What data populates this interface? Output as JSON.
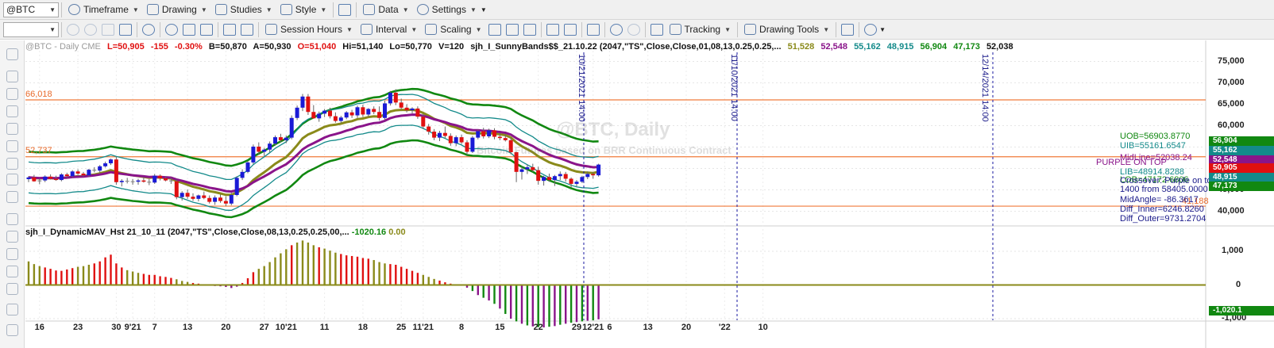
{
  "toolbar1": {
    "symbol": "@BTC",
    "items": [
      "Timeframe",
      "Drawing",
      "Studies",
      "Style",
      "Data",
      "Settings"
    ]
  },
  "toolbar2": {
    "session_label": "Session Hours",
    "interval_label": "Interval",
    "scaling_label": "Scaling",
    "tracking_label": "Tracking",
    "drawing_tools_label": "Drawing Tools"
  },
  "legend": {
    "symbol": "@BTC - Daily  CME",
    "last": "L=50,905",
    "change": "-155",
    "pct": "-0.30%",
    "bid": "B=50,870",
    "ask": "A=50,930",
    "open": "O=51,040",
    "high": "Hi=51,140",
    "low": "Lo=50,770",
    "volume": "V=120",
    "study": "sjh_I_SunnyBands$$_21.10.22 (2047,\"TS\",Close,Close,01,08,13,0.25,0.25,...",
    "v1": "51,528",
    "v2": "52,548",
    "v3": "55,162",
    "v4": "48,915",
    "v5": "56,904",
    "v6": "47,173",
    "v7": "52,038"
  },
  "legend2": {
    "study": "sjh_I_DynamicMAV_Hst 21_10_11 (2047,\"TS\",Close,Close,08,13,0.25,0.25,00,...",
    "v1": "-1020.16",
    "v2": "0.00"
  },
  "price_axis": [
    "75,000",
    "70,000",
    "65,000",
    "60,000",
    "55,000",
    "50,000",
    "45,000",
    "40,000"
  ],
  "osc_axis": [
    "1,000",
    "0",
    "-1,000"
  ],
  "x_axis": [
    "16",
    "23",
    "30",
    "9'21",
    "7",
    "13",
    "20",
    "27",
    "10'21",
    "11",
    "18",
    "25",
    "11'21",
    "8",
    "15",
    "22",
    "29",
    "12'21",
    "6",
    "13",
    "20",
    "'22",
    "10"
  ],
  "hlines": {
    "h1": "66,018",
    "h2": "52,737",
    "h3": "41,188"
  },
  "badges": {
    "uob": "56,904",
    "uib": "55,162",
    "mid": "52,548",
    "last": "50,905",
    "lib": "48,915",
    "lob": "47,173",
    "osc": "-1,020.1"
  },
  "annotations": {
    "uob": "UOB=56903.8770",
    "uib": "UIB=55161.6547",
    "midline": "MidLine=52038.24",
    "purple": "PURPLE ON TOP",
    "lib": "LIB=48914.8288",
    "lob": "LOB=47172.6806",
    "crossover": "Crossover: Purple on top at",
    "crossover2": "1400 from 58405.0000",
    "midangle": "MidAngle= -86.3617",
    "diff_inner": "Diff_Inner=6246.8260",
    "diff_outer": "Diff_Outer=9731.2704"
  },
  "vdates": [
    "10/21/2021 14:00",
    "11/10/2021 14:00",
    "12/14/2021 14:00"
  ],
  "watermark": "@BTC, Daily",
  "watermark2": "Bitcoin Futures based on BRR Continuous Contract",
  "colors": {
    "up": "#1a1ad6",
    "down": "#e01010",
    "doji": "#808080",
    "outer_band": "#118811",
    "inner_band": "#138a8a",
    "olive": "#8a8a1a",
    "purple": "#8a148a",
    "orange": "#f07a3a"
  },
  "chart_data": {
    "type": "candlestick",
    "price_range": [
      37500,
      77500
    ],
    "osc_range": [
      -1000,
      1400
    ],
    "candles": [
      [
        47500,
        48200,
        46800,
        47900
      ],
      [
        47900,
        48500,
        46900,
        47000
      ],
      [
        47000,
        47600,
        46300,
        47200
      ],
      [
        47200,
        48400,
        46800,
        48100
      ],
      [
        48100,
        48600,
        47400,
        47600
      ],
      [
        47600,
        48300,
        47100,
        47300
      ],
      [
        47300,
        48900,
        47000,
        48600
      ],
      [
        48600,
        49000,
        47800,
        48200
      ],
      [
        48200,
        49600,
        47900,
        49300
      ],
      [
        49300,
        49800,
        48500,
        48800
      ],
      [
        48800,
        49200,
        48100,
        48400
      ],
      [
        48400,
        49900,
        48100,
        49700
      ],
      [
        49700,
        50300,
        49100,
        49500
      ],
      [
        49500,
        50800,
        49000,
        50500
      ],
      [
        50500,
        51600,
        50200,
        51200
      ],
      [
        51200,
        52300,
        50800,
        52100
      ],
      [
        52100,
        52700,
        46200,
        46800
      ],
      [
        46800,
        47500,
        45800,
        47100
      ],
      [
        47100,
        47800,
        46500,
        47000
      ],
      [
        47000,
        47500,
        46200,
        46900
      ],
      [
        46900,
        47600,
        46200,
        47200
      ],
      [
        47200,
        48000,
        46700,
        46900
      ],
      [
        46900,
        47500,
        46100,
        46700
      ],
      [
        46700,
        48700,
        46400,
        48300
      ],
      [
        48300,
        48600,
        47200,
        47700
      ],
      [
        47700,
        48200,
        47000,
        47200
      ],
      [
        47200,
        47900,
        46400,
        47000
      ],
      [
        47000,
        47400,
        42800,
        43300
      ],
      [
        43300,
        44700,
        42500,
        44300
      ],
      [
        44300,
        45100,
        42900,
        43400
      ],
      [
        43400,
        44200,
        42400,
        42900
      ],
      [
        42900,
        43900,
        42300,
        43700
      ],
      [
        43700,
        44600,
        42800,
        43100
      ],
      [
        43100,
        43700,
        41800,
        42200
      ],
      [
        42200,
        43700,
        41500,
        43200
      ],
      [
        43200,
        43900,
        42000,
        42400
      ],
      [
        42400,
        43500,
        41200,
        41800
      ],
      [
        41800,
        44300,
        41400,
        43800
      ],
      [
        43800,
        48200,
        43500,
        47800
      ],
      [
        47800,
        49800,
        47300,
        49200
      ],
      [
        49200,
        51800,
        48900,
        51400
      ],
      [
        51400,
        55600,
        51000,
        55100
      ],
      [
        55100,
        56100,
        53200,
        53900
      ],
      [
        53900,
        54800,
        52900,
        54400
      ],
      [
        54400,
        56300,
        53800,
        55800
      ],
      [
        55800,
        57700,
        55300,
        57300
      ],
      [
        57300,
        58100,
        56100,
        56600
      ],
      [
        56600,
        57700,
        55900,
        57200
      ],
      [
        57200,
        62400,
        56800,
        61800
      ],
      [
        61800,
        64700,
        61300,
        64200
      ],
      [
        64200,
        67400,
        63400,
        66800
      ],
      [
        66800,
        67400,
        62500,
        63200
      ],
      [
        63200,
        64800,
        62100,
        61700
      ],
      [
        61700,
        63300,
        60900,
        62800
      ],
      [
        62800,
        63900,
        62000,
        63500
      ],
      [
        63500,
        64200,
        61700,
        62200
      ],
      [
        62200,
        63100,
        60700,
        61100
      ],
      [
        61100,
        62300,
        60600,
        61900
      ],
      [
        61900,
        63400,
        61500,
        63100
      ],
      [
        63100,
        63700,
        61800,
        62400
      ],
      [
        62400,
        64700,
        61800,
        64300
      ],
      [
        64300,
        64900,
        62000,
        62600
      ],
      [
        62600,
        64100,
        62100,
        63900
      ],
      [
        63900,
        64500,
        62700,
        63200
      ],
      [
        63200,
        64500,
        61200,
        61800
      ],
      [
        61800,
        65800,
        61300,
        65200
      ],
      [
        65200,
        68100,
        64700,
        67700
      ],
      [
        67700,
        68500,
        64800,
        65400
      ],
      [
        65400,
        66300,
        63800,
        64200
      ],
      [
        64200,
        65000,
        63100,
        63600
      ],
      [
        63600,
        64300,
        62900,
        64000
      ],
      [
        64000,
        64500,
        61600,
        62100
      ],
      [
        62100,
        62800,
        59200,
        59800
      ],
      [
        59800,
        60400,
        57900,
        58600
      ],
      [
        58600,
        59200,
        56600,
        57200
      ],
      [
        57200,
        58800,
        56400,
        58300
      ],
      [
        58300,
        59800,
        57100,
        57600
      ],
      [
        57600,
        58200,
        55300,
        55900
      ],
      [
        55900,
        57700,
        55200,
        57300
      ],
      [
        57300,
        57900,
        55700,
        56100
      ],
      [
        56100,
        56600,
        53200,
        53900
      ],
      [
        53900,
        57600,
        53600,
        57200
      ],
      [
        57200,
        59100,
        56800,
        58700
      ],
      [
        58700,
        59500,
        57000,
        57500
      ],
      [
        57500,
        59300,
        57100,
        58900
      ],
      [
        58900,
        59400,
        56800,
        57400
      ],
      [
        57400,
        58200,
        56600,
        57100
      ],
      [
        57100,
        57900,
        56300,
        56600
      ],
      [
        56600,
        57200,
        53300,
        53800
      ],
      [
        53800,
        53900,
        46800,
        49200
      ],
      [
        49200,
        50500,
        47400,
        49800
      ],
      [
        49800,
        50900,
        48700,
        50300
      ],
      [
        50300,
        51100,
        49200,
        49600
      ],
      [
        49600,
        50400,
        46200,
        47100
      ],
      [
        47100,
        48300,
        46000,
        48000
      ],
      [
        48000,
        48800,
        46900,
        47300
      ],
      [
        47300,
        48500,
        45900,
        48200
      ],
      [
        48200,
        49300,
        47300,
        48700
      ],
      [
        48700,
        49200,
        46900,
        47600
      ],
      [
        47600,
        47900,
        45600,
        46400
      ],
      [
        46400,
        47300,
        45800,
        46900
      ],
      [
        46900,
        48300,
        46600,
        48000
      ],
      [
        48000,
        49300,
        47500,
        48700
      ],
      [
        48700,
        49100,
        47600,
        48400
      ],
      [
        48400,
        51100,
        48100,
        50905
      ]
    ],
    "osc": [
      700,
      620,
      560,
      520,
      480,
      430,
      420,
      460,
      500,
      540,
      560,
      600,
      640,
      700,
      820,
      900,
      640,
      520,
      440,
      400,
      360,
      330,
      300,
      300,
      260,
      240,
      210,
      170,
      120,
      90,
      60,
      40,
      20,
      0,
      -30,
      -40,
      -60,
      -90,
      -50,
      60,
      200,
      380,
      480,
      560,
      680,
      820,
      940,
      1060,
      1180,
      1260,
      1320,
      1260,
      1180,
      1120,
      1080,
      1020,
      960,
      920,
      880,
      860,
      840,
      800,
      780,
      740,
      680,
      640,
      620,
      600,
      540,
      480,
      420,
      360,
      300,
      240,
      180,
      130,
      80,
      40,
      20,
      -20,
      -80,
      -180,
      -300,
      -380,
      -460,
      -560,
      -700,
      -860,
      -1000,
      -1080,
      -1150,
      -1200,
      -1230,
      -1250,
      -1260,
      -1240,
      -1220,
      -1180,
      -1150,
      -1120,
      -1100,
      -1080,
      -1060,
      -1050,
      -1020
    ]
  }
}
